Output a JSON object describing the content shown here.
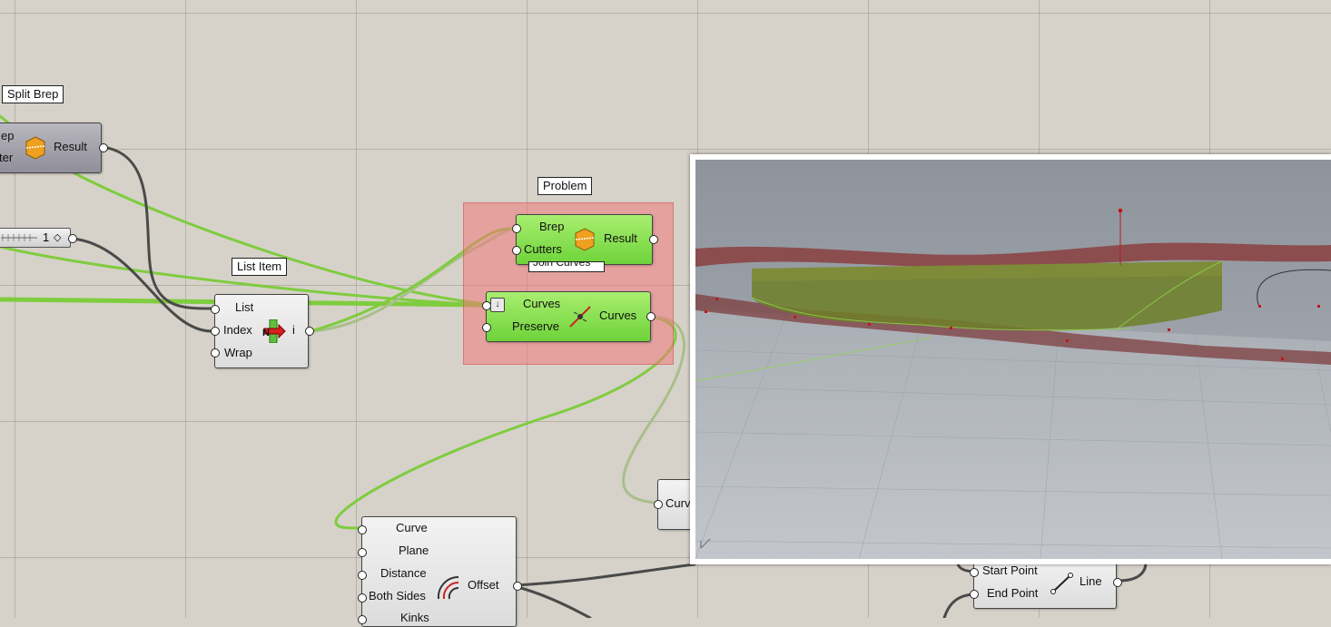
{
  "tags": {
    "split_brep": "Split Brep",
    "problem": "Problem",
    "list_item": "List Item",
    "join_curves_hidden": "Join Curves"
  },
  "split_brep_top": {
    "inputs": [
      "ep",
      "ter"
    ],
    "output": "Result"
  },
  "slider": {
    "value": "1"
  },
  "list_item": {
    "inputs": [
      "List",
      "Index",
      "Wrap"
    ],
    "output": "i"
  },
  "split_brep_green": {
    "inputs": [
      "Brep",
      "Cutters"
    ],
    "output": "Result"
  },
  "join_curves": {
    "inputs": [
      "Curves",
      "Preserve"
    ],
    "output": "Curves"
  },
  "offset": {
    "inputs": [
      "Curve",
      "Plane",
      "Distance",
      "Both Sides",
      "Kinks"
    ],
    "output": "Offset"
  },
  "partial_node": {
    "input": "Curv"
  },
  "line": {
    "inputs": [
      "Start Point",
      "End Point"
    ],
    "output": "Line"
  },
  "colors": {
    "canvas": "#d6d2c9",
    "wire_green": "#7fcc3f",
    "wire_dark": "#4a4a4a",
    "group_red": "#f07878",
    "component_green": "#8ee255",
    "viewport_bg": "#a4aab2",
    "surface_red": "#8a3a3a",
    "volume_green": "#6f7f28"
  }
}
